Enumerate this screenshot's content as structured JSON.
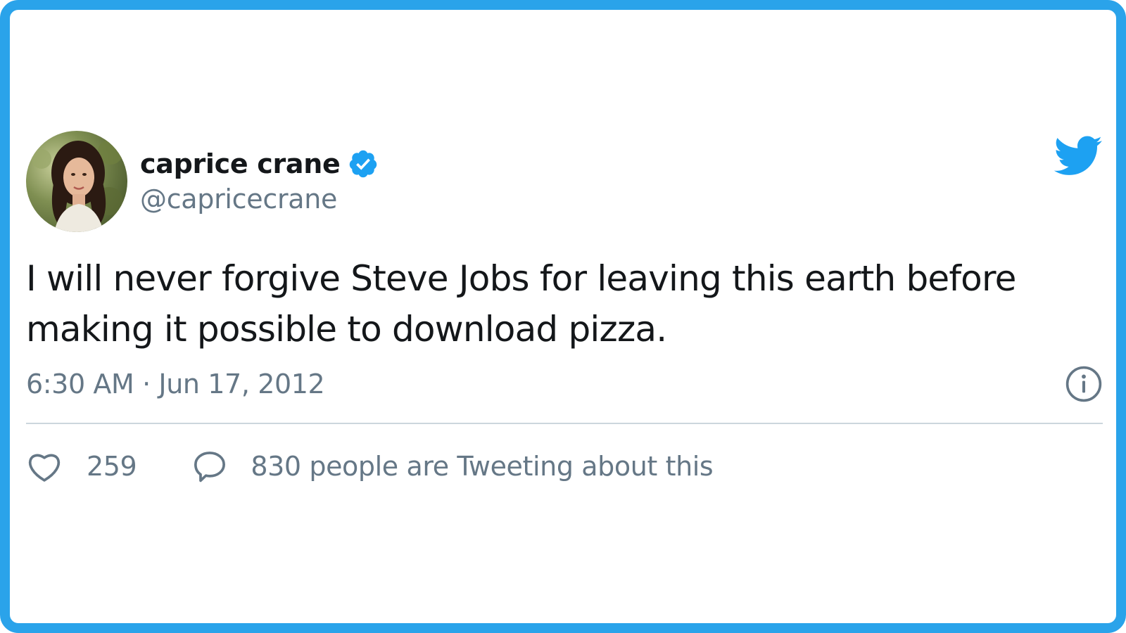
{
  "tweet": {
    "author": {
      "display_name": "caprice crane",
      "handle": "@capricecrane",
      "verified": true
    },
    "text": "I will never forgive Steve Jobs for leaving this earth before making it possible to download pizza.",
    "timestamp": "6:30 AM · Jun 17, 2012",
    "likes": "259",
    "tweeting_about": "830 people are Tweeting about this"
  },
  "colors": {
    "frame": "#2aa3ea",
    "brand": "#1da1f2",
    "text": "#14171a",
    "secondary": "#657786",
    "divider": "#ccd6dd"
  },
  "icons": {
    "brand": "twitter-bird-icon",
    "verified": "verified-badge-icon",
    "info": "info-icon",
    "like": "heart-icon",
    "reply": "speech-bubble-icon"
  }
}
